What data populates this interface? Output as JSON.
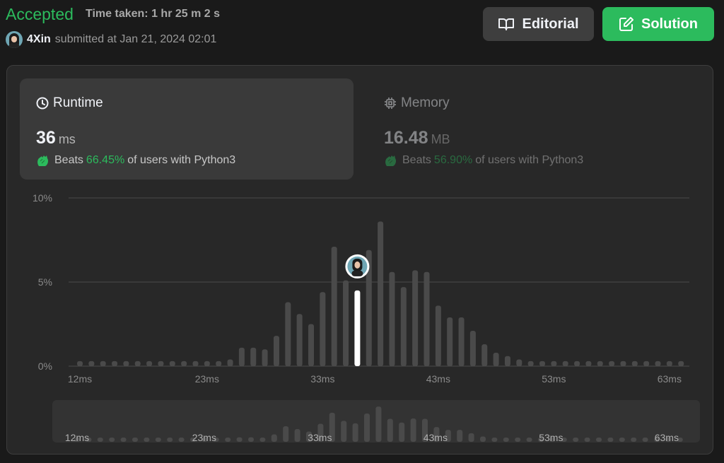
{
  "header": {
    "status": "Accepted",
    "time_taken": "Time taken: 1 hr 25 m 2 s",
    "username": "4Xin",
    "submitted_text": "submitted at Jan 21, 2024 02:01",
    "editorial_label": "Editorial",
    "solution_label": "Solution"
  },
  "runtime": {
    "title": "Runtime",
    "value": "36",
    "unit": "ms",
    "beats_label": "Beats",
    "beats_pct": "66.45%",
    "beats_suffix": "of users with Python3"
  },
  "memory": {
    "title": "Memory",
    "value": "16.48",
    "unit": "MB",
    "beats_label": "Beats",
    "beats_pct": "56.90%",
    "beats_suffix": "of users with Python3"
  },
  "colors": {
    "accent_green": "#2cbb5d",
    "bar": "#4a4a4a",
    "selected_bar": "#ffffff"
  },
  "chart_data": {
    "type": "bar",
    "y_ticks": [
      "10%",
      "5%",
      "0%"
    ],
    "ylim": [
      0,
      10
    ],
    "x_tick_labels": [
      "12ms",
      "23ms",
      "33ms",
      "43ms",
      "53ms",
      "63ms"
    ],
    "x_tick_values": [
      12,
      23,
      33,
      43,
      53,
      63
    ],
    "selected_x": 36,
    "bars": [
      {
        "x": 12,
        "y": 0.3
      },
      {
        "x": 13,
        "y": 0.3
      },
      {
        "x": 14,
        "y": 0.3
      },
      {
        "x": 15,
        "y": 0.3
      },
      {
        "x": 16,
        "y": 0.3
      },
      {
        "x": 17,
        "y": 0.3
      },
      {
        "x": 18,
        "y": 0.3
      },
      {
        "x": 19,
        "y": 0.3
      },
      {
        "x": 20,
        "y": 0.3
      },
      {
        "x": 21,
        "y": 0.3
      },
      {
        "x": 22,
        "y": 0.3
      },
      {
        "x": 23,
        "y": 0.3
      },
      {
        "x": 24,
        "y": 0.3
      },
      {
        "x": 25,
        "y": 0.4
      },
      {
        "x": 26,
        "y": 1.1
      },
      {
        "x": 27,
        "y": 1.1
      },
      {
        "x": 28,
        "y": 1.0
      },
      {
        "x": 29,
        "y": 1.8
      },
      {
        "x": 30,
        "y": 3.8
      },
      {
        "x": 31,
        "y": 3.1
      },
      {
        "x": 32,
        "y": 2.5
      },
      {
        "x": 33,
        "y": 4.4
      },
      {
        "x": 34,
        "y": 7.1
      },
      {
        "x": 35,
        "y": 5.1
      },
      {
        "x": 36,
        "y": 4.5
      },
      {
        "x": 37,
        "y": 6.9
      },
      {
        "x": 38,
        "y": 8.6
      },
      {
        "x": 39,
        "y": 5.6
      },
      {
        "x": 40,
        "y": 4.7
      },
      {
        "x": 41,
        "y": 5.7
      },
      {
        "x": 42,
        "y": 5.6
      },
      {
        "x": 43,
        "y": 3.6
      },
      {
        "x": 44,
        "y": 2.9
      },
      {
        "x": 45,
        "y": 2.9
      },
      {
        "x": 46,
        "y": 2.1
      },
      {
        "x": 47,
        "y": 1.3
      },
      {
        "x": 48,
        "y": 0.8
      },
      {
        "x": 49,
        "y": 0.6
      },
      {
        "x": 50,
        "y": 0.4
      },
      {
        "x": 51,
        "y": 0.3
      },
      {
        "x": 52,
        "y": 0.3
      },
      {
        "x": 53,
        "y": 0.3
      },
      {
        "x": 54,
        "y": 0.3
      },
      {
        "x": 55,
        "y": 0.3
      },
      {
        "x": 56,
        "y": 0.3
      },
      {
        "x": 57,
        "y": 0.3
      },
      {
        "x": 58,
        "y": 0.3
      },
      {
        "x": 59,
        "y": 0.3
      },
      {
        "x": 60,
        "y": 0.3
      },
      {
        "x": 61,
        "y": 0.3
      },
      {
        "x": 62,
        "y": 0.3
      },
      {
        "x": 63,
        "y": 0.3
      },
      {
        "x": 64,
        "y": 0.3
      }
    ]
  }
}
